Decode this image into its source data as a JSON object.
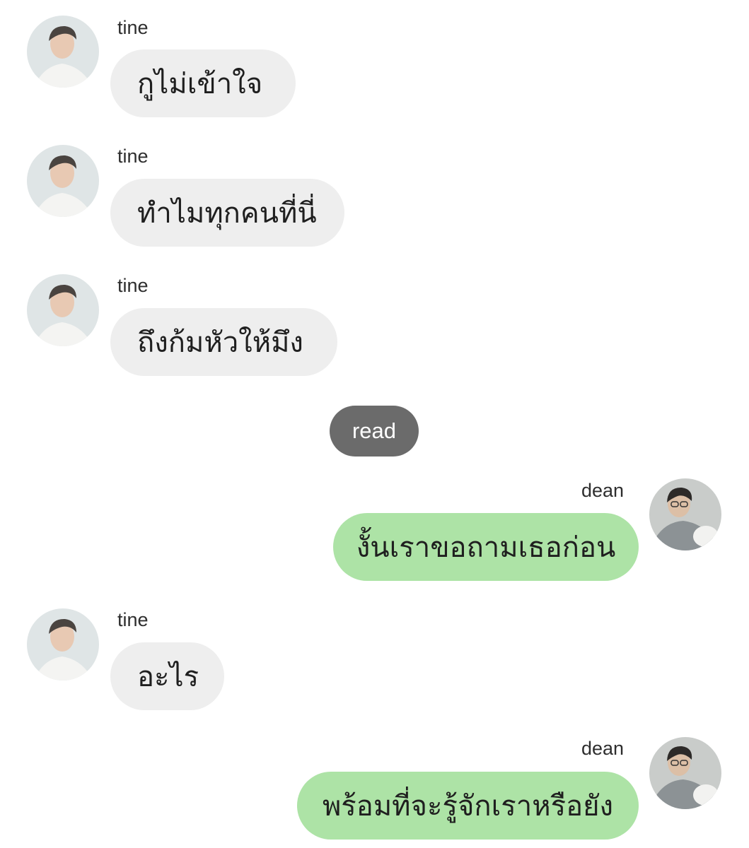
{
  "messages": [
    {
      "sender": "tine",
      "text": "กูไม่เข้าใจ"
    },
    {
      "sender": "tine",
      "text": "ทำไมทุกคนที่นี่"
    },
    {
      "sender": "tine",
      "text": "ถึงก้มหัวให้มึง"
    },
    {
      "sender": "dean",
      "text": "งั้นเราขอถามเธอก่อน"
    },
    {
      "sender": "tine",
      "text": "อะไร"
    },
    {
      "sender": "dean",
      "text": "พร้อมที่จะรู้จักเราหรือยัง"
    }
  ],
  "status": {
    "read_label": "read"
  },
  "colors": {
    "incoming_bubble": "#eeeeee",
    "outgoing_bubble": "#ade3a6",
    "read_badge": "#6b6b6b"
  },
  "icons": {
    "tine_avatar": "profile-photo",
    "dean_avatar": "profile-photo"
  }
}
